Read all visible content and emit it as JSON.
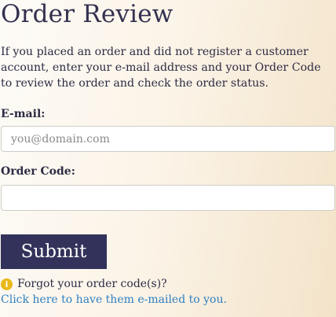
{
  "page": {
    "title": "Order Review",
    "intro": "If you placed an order and did not register a customer account, enter your e-mail address and your Order Code to review the order and check the order status."
  },
  "form": {
    "email_label": "E-mail:",
    "email_placeholder": "you@domain.com",
    "email_value": "",
    "code_label": "Order Code:",
    "code_placeholder": "",
    "code_value": "",
    "submit_label": "Submit"
  },
  "help": {
    "icon": "info-icon",
    "forgot_text": "Forgot your order code(s)?",
    "link_text": "Click here to have them e-mailed to you."
  },
  "colors": {
    "button_bg": "#33325a",
    "link": "#2f7fc1",
    "info_icon": "#e9b91a"
  }
}
